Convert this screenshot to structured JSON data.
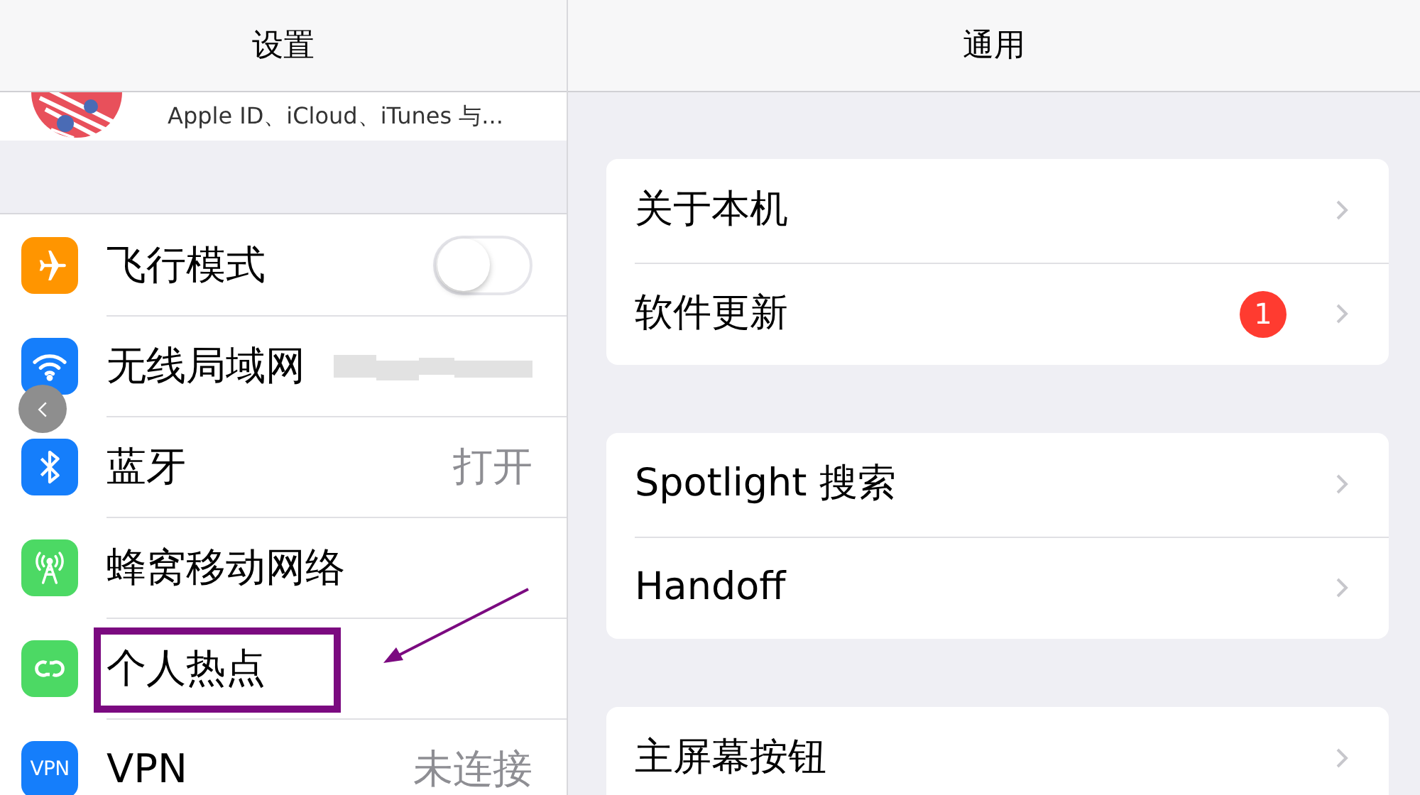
{
  "master": {
    "title": "设置",
    "profile": {
      "subtitle": "Apple ID、iCloud、iTunes 与..."
    },
    "rows": [
      {
        "kind": "toggle",
        "label": "飞行模式",
        "on": false,
        "annotated": false
      },
      {
        "kind": "blurred",
        "label": "无线局域网",
        "annotated": false
      },
      {
        "kind": "value",
        "label": "蓝牙",
        "value": "打开",
        "annotated": false
      },
      {
        "kind": "plain",
        "label": "蜂窝移动网络",
        "annotated": false
      },
      {
        "kind": "plain",
        "label": "个人热点",
        "annotated": true
      },
      {
        "kind": "value",
        "icon_text": "VPN",
        "label": "VPN",
        "value": "未连接",
        "annotated": false
      }
    ]
  },
  "detail": {
    "title": "通用",
    "groups": [
      [
        {
          "label": "关于本机"
        },
        {
          "label": "软件更新",
          "badge": "1"
        }
      ],
      [
        {
          "label": "Spotlight 搜索"
        },
        {
          "label": "Handoff"
        }
      ],
      [
        {
          "label": "主屏幕按钮"
        }
      ]
    ]
  }
}
